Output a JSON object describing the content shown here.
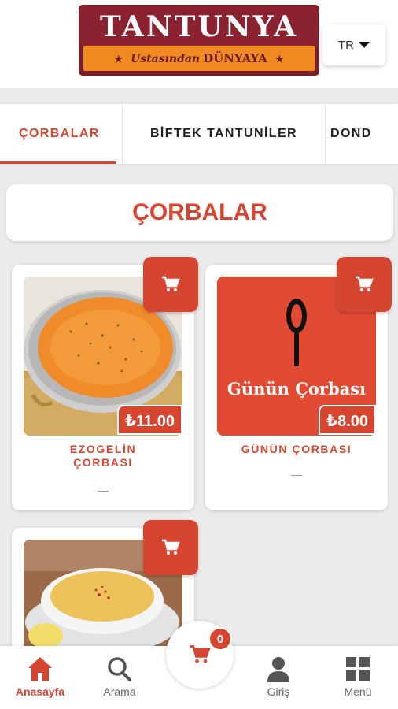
{
  "header": {
    "logo_title": "TANTUNYA",
    "logo_script": "Ustasından",
    "logo_word": "DÜNYAYA",
    "language": "TR"
  },
  "tabs": [
    "ÇORBALAR",
    "BİFTEK TANTUNİLER",
    "DOND"
  ],
  "section_title": "ÇORBALAR",
  "products": [
    {
      "name_line1": "EZOGELİN",
      "name_line2": "ÇORBASI",
      "price": "₺11.00",
      "desc": "—",
      "icon": "cart-icon"
    },
    {
      "name_line1": "GÜNÜN ÇORBASI",
      "name_line2": "",
      "price": "₺8.00",
      "desc": "—",
      "image_text": "Günün Çorbası",
      "icon": "cart-icon"
    },
    {
      "name_line1": "",
      "name_line2": "",
      "icon": "cart-icon"
    }
  ],
  "bottom_nav": {
    "home": "Anasayfa",
    "search": "Arama",
    "login": "Giriş",
    "menu": "Menü",
    "cart_count": "0"
  },
  "colors": {
    "accent": "#d64530",
    "logo_red": "#8a2230",
    "logo_orange": "#f0891f"
  }
}
